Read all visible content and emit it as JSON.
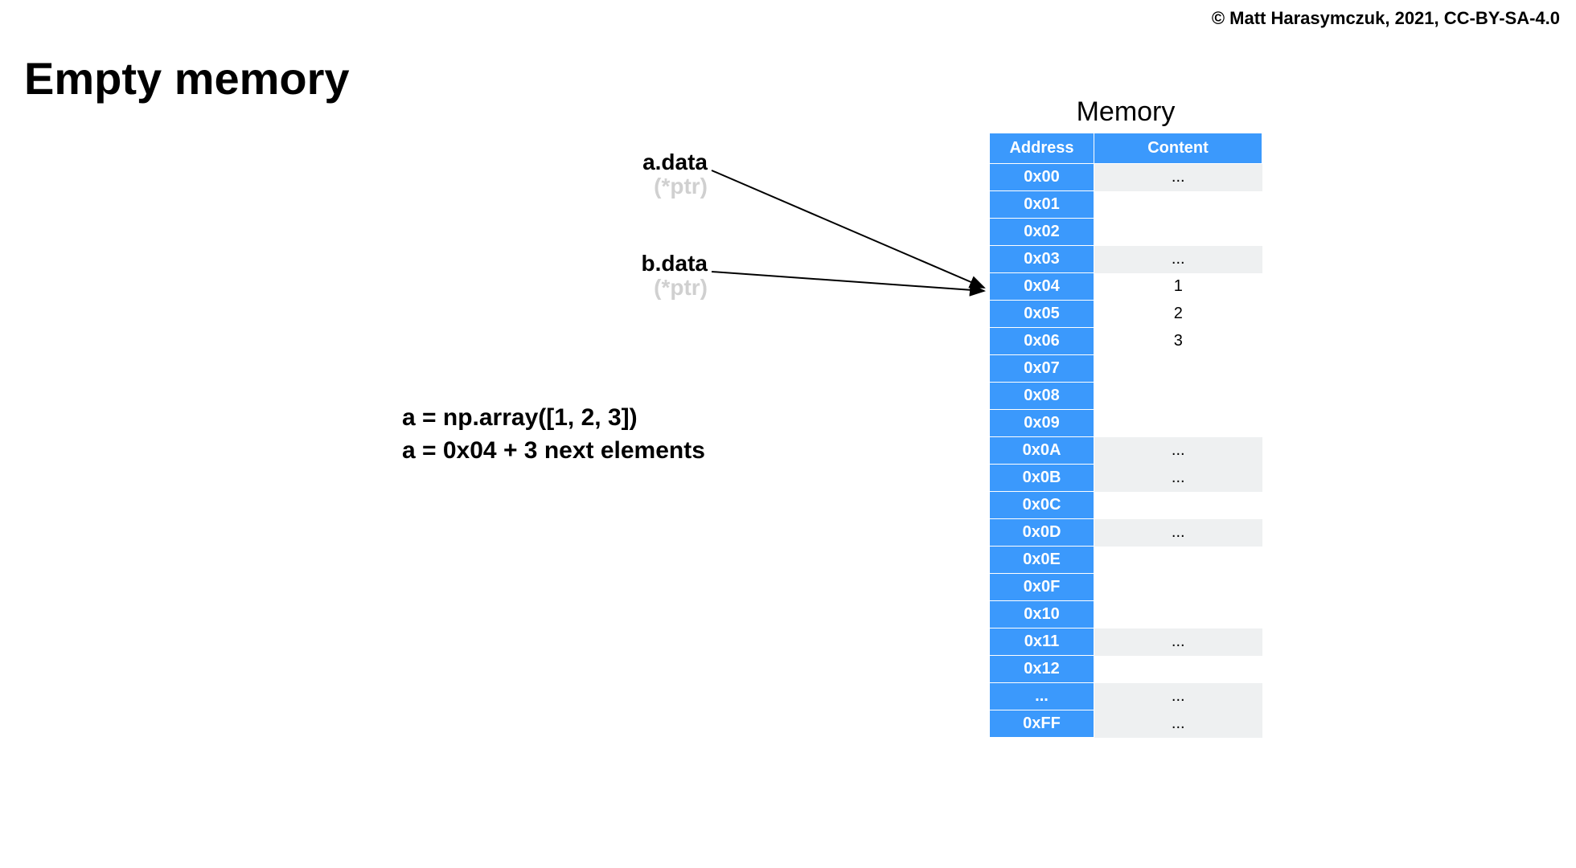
{
  "copyright": "© Matt Harasymczuk, 2021, CC-BY-SA-4.0",
  "title": "Empty memory",
  "pointers": {
    "a": {
      "label": "a.data",
      "sub": "(*ptr)"
    },
    "b": {
      "label": "b.data",
      "sub": "(*ptr)"
    }
  },
  "code": {
    "line1": "a = np.array([1, 2, 3])",
    "line2": "a = 0x04 + 3 next elements"
  },
  "memory": {
    "title": "Memory",
    "headers": {
      "address": "Address",
      "content": "Content"
    },
    "rows": [
      {
        "address": "0x00",
        "content": "...",
        "shaded": true
      },
      {
        "address": "0x01",
        "content": "",
        "shaded": false
      },
      {
        "address": "0x02",
        "content": "",
        "shaded": false
      },
      {
        "address": "0x03",
        "content": "...",
        "shaded": true
      },
      {
        "address": "0x04",
        "content": "1",
        "shaded": false
      },
      {
        "address": "0x05",
        "content": "2",
        "shaded": false
      },
      {
        "address": "0x06",
        "content": "3",
        "shaded": false
      },
      {
        "address": "0x07",
        "content": "",
        "shaded": false
      },
      {
        "address": "0x08",
        "content": "",
        "shaded": false
      },
      {
        "address": "0x09",
        "content": "",
        "shaded": false
      },
      {
        "address": "0x0A",
        "content": "...",
        "shaded": true
      },
      {
        "address": "0x0B",
        "content": "...",
        "shaded": true
      },
      {
        "address": "0x0C",
        "content": "",
        "shaded": false
      },
      {
        "address": "0x0D",
        "content": "...",
        "shaded": true
      },
      {
        "address": "0x0E",
        "content": "",
        "shaded": false
      },
      {
        "address": "0x0F",
        "content": "",
        "shaded": false
      },
      {
        "address": "0x10",
        "content": "",
        "shaded": false
      },
      {
        "address": "0x11",
        "content": "...",
        "shaded": true
      },
      {
        "address": "0x12",
        "content": "",
        "shaded": false
      },
      {
        "address": "...",
        "content": "...",
        "shaded": true
      },
      {
        "address": "0xFF",
        "content": "...",
        "shaded": true
      }
    ]
  }
}
